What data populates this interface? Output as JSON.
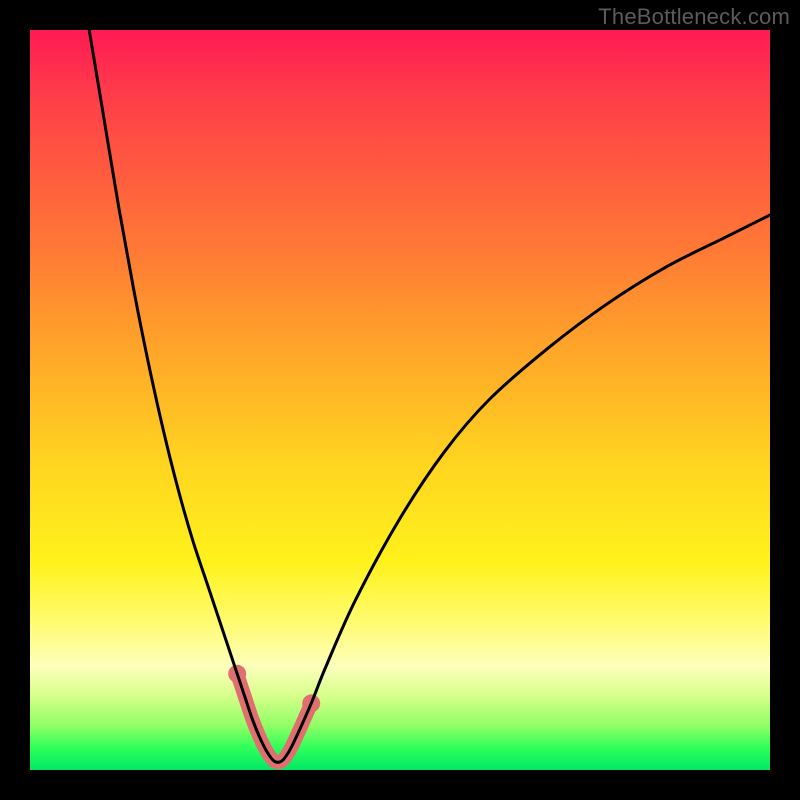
{
  "watermark": "TheBottleneck.com",
  "chart_data": {
    "type": "line",
    "title": "",
    "xlabel": "",
    "ylabel": "",
    "xlim": [
      0,
      100
    ],
    "ylim": [
      0,
      100
    ],
    "series": [
      {
        "name": "bottleneck-curve",
        "x": [
          8,
          10,
          12,
          14,
          16,
          18,
          20,
          22,
          24,
          26,
          28,
          29,
          30,
          31,
          32,
          33,
          34,
          35,
          36,
          38,
          40,
          44,
          50,
          56,
          62,
          70,
          78,
          86,
          94,
          100
        ],
        "y": [
          100,
          88,
          76,
          65,
          55,
          46,
          38,
          31,
          25,
          19,
          13,
          10,
          7,
          4.5,
          2.5,
          1.2,
          1.2,
          2.5,
          4.5,
          9,
          14,
          23,
          34,
          43,
          50,
          57,
          63,
          68,
          72,
          75
        ]
      }
    ],
    "highlight": {
      "name": "optimal-range",
      "color": "#e07070",
      "x": [
        28,
        29,
        30,
        31,
        32,
        33,
        34,
        35,
        36,
        38
      ],
      "y": [
        13,
        10,
        7,
        4.5,
        2.5,
        1.2,
        1.2,
        2.5,
        4.5,
        9
      ],
      "end_dots_x": [
        28,
        38
      ],
      "end_dots_y": [
        13,
        9
      ]
    },
    "gradient_stops": [
      {
        "pos": 0.0,
        "color": "#ff1a55"
      },
      {
        "pos": 0.42,
        "color": "#ffa22a"
      },
      {
        "pos": 0.72,
        "color": "#fff21c"
      },
      {
        "pos": 0.9,
        "color": "#d6ff8a"
      },
      {
        "pos": 1.0,
        "color": "#00e865"
      }
    ]
  }
}
